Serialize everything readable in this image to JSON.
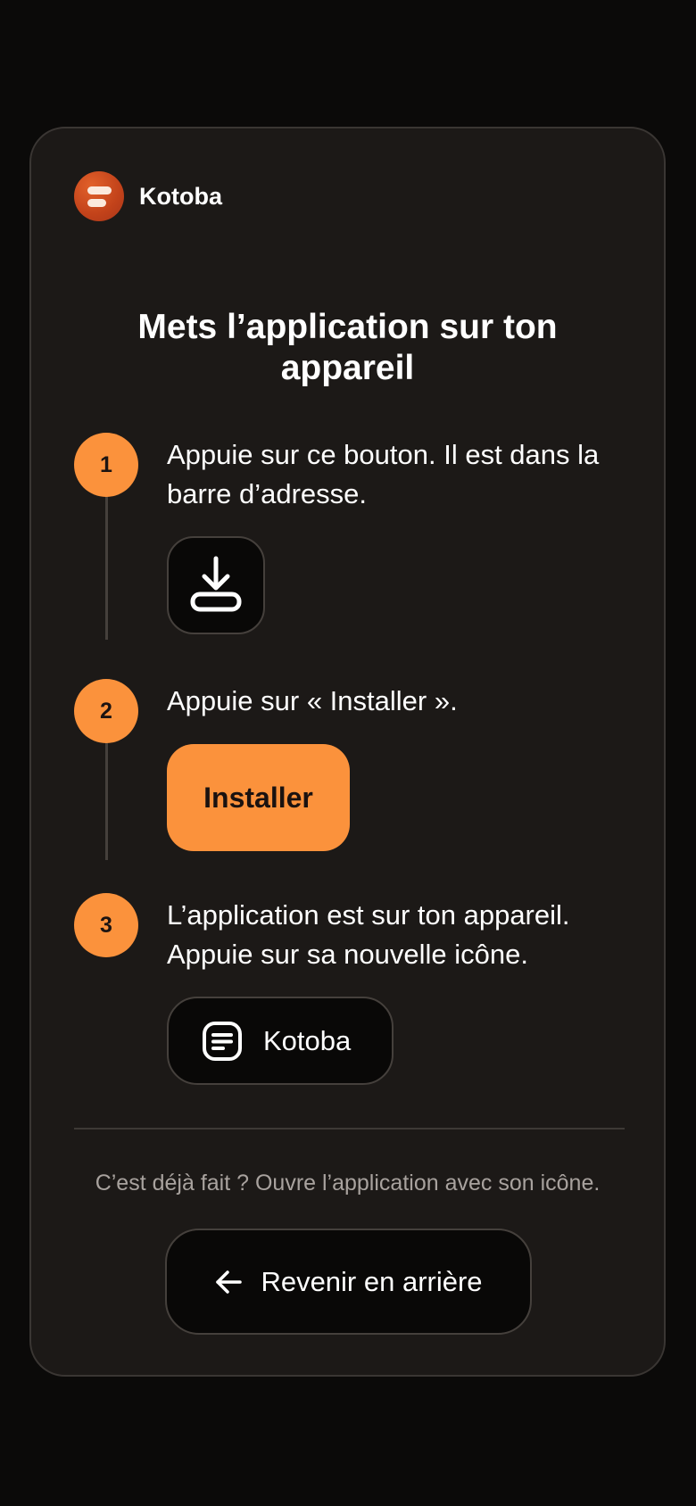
{
  "brand": {
    "name": "Kotoba",
    "logo_color": "#c2421a"
  },
  "title": "Mets l’application sur ton appareil",
  "steps": [
    {
      "number": "1",
      "text": "Appuie sur ce bouton. Il est dans la barre d’adresse.",
      "visual": "download-icon"
    },
    {
      "number": "2",
      "text": "Appuie sur « Installer ».",
      "button_label": "Installer"
    },
    {
      "number": "3",
      "text": "L’application est sur ton appareil. Appuie sur sa nouvelle icône.",
      "app_label": "Kotoba",
      "visual": "app-list-icon"
    }
  ],
  "footer": {
    "hint": "C’est déjà fait ? Ouvre l’application avec son icône.",
    "back_label": "Revenir en arrière",
    "back_icon": "arrow-left-icon"
  },
  "colors": {
    "accent": "#fb923c",
    "card_background": "#1c1917",
    "page_background": "#0b0a09"
  }
}
